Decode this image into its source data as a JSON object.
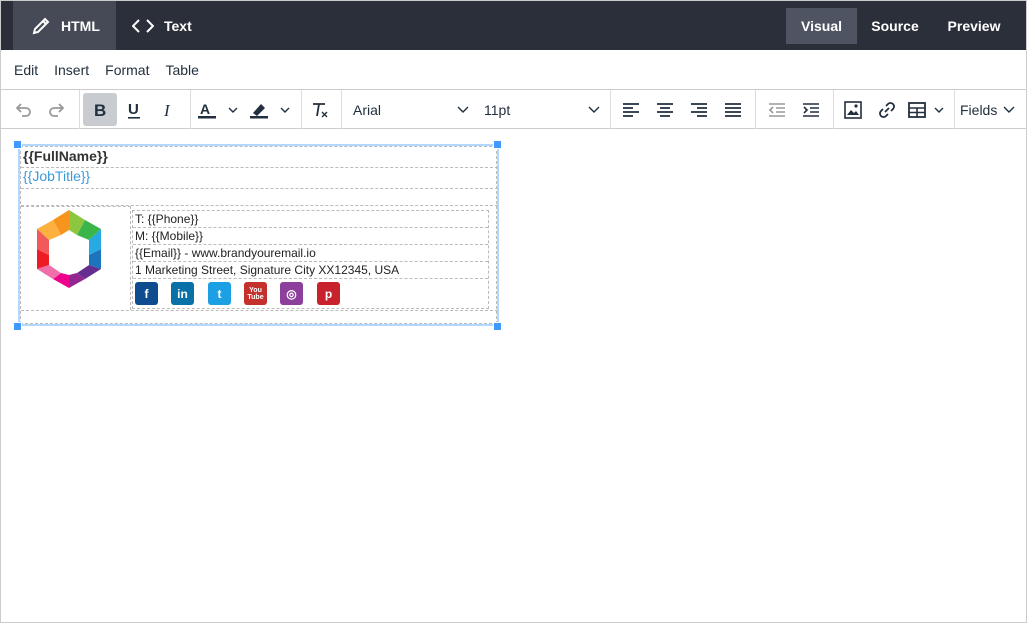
{
  "topbar": {
    "mode_tabs": [
      {
        "label": "HTML",
        "icon": "pencil-icon"
      },
      {
        "label": "Text",
        "icon": "code-icon"
      }
    ],
    "view_tabs": [
      "Visual",
      "Source",
      "Preview"
    ]
  },
  "menubar": [
    "Edit",
    "Insert",
    "Format",
    "Table"
  ],
  "toolbar": {
    "font_family": "Arial",
    "font_size": "11pt",
    "fields_label": "Fields"
  },
  "signature": {
    "fullname": "{{FullName}}",
    "jobtitle": "{{JobTitle}}",
    "phone": "T: {{Phone}}",
    "mobile": "M: {{Mobile}}",
    "email_web": "{{Email}} - www.brandyouremail.io",
    "address": "1 Marketing Street, Signature City XX12345, USA",
    "social": [
      {
        "name": "facebook-icon",
        "glyph": "f",
        "color": "#0e4b8f"
      },
      {
        "name": "linkedin-icon",
        "glyph": "in",
        "color": "#0a70a8"
      },
      {
        "name": "twitter-icon",
        "glyph": "t",
        "color": "#1da0e3"
      },
      {
        "name": "youtube-icon",
        "glyph": "You Tube",
        "color": "#c4302b"
      },
      {
        "name": "instagram-icon",
        "glyph": "◎",
        "color": "#8d3f9c"
      },
      {
        "name": "pinterest-icon",
        "glyph": "p",
        "color": "#c8232c"
      }
    ]
  },
  "colors": {
    "topbar_bg": "#2b2f3a",
    "active_mode_bg": "#454a56",
    "active_view_bg": "#4f5462",
    "selection": "#4099ff",
    "jobtitle": "#3a9ad9"
  }
}
